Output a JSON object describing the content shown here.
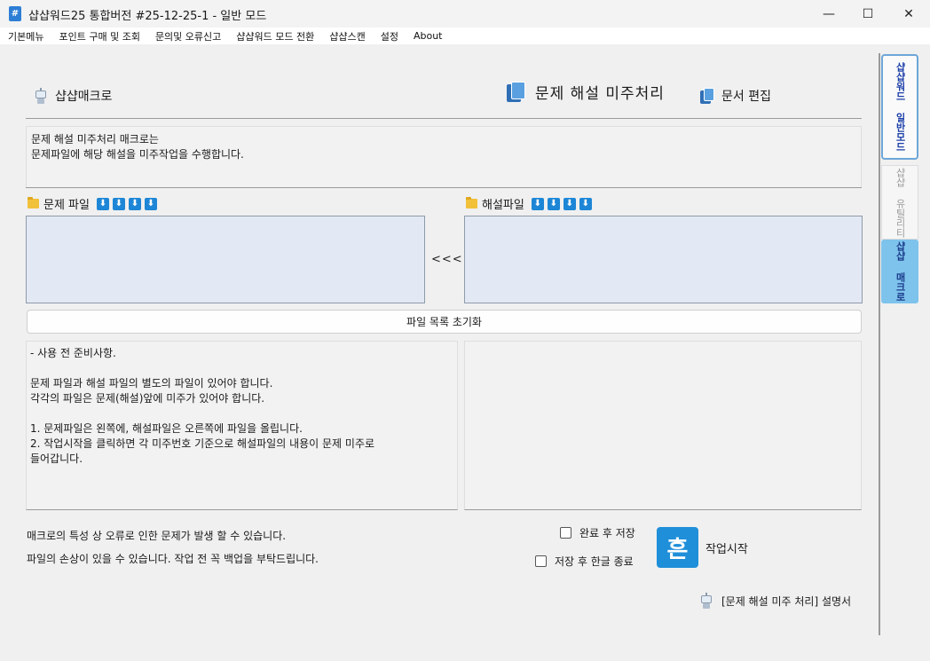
{
  "window": {
    "title": "샵샵워드25 통합버전 #25-12-25-1 - 일반 모드",
    "minimize": "—",
    "maximize": "☐",
    "close": "✕"
  },
  "menu": {
    "items": [
      "기본메뉴",
      "포인트 구매 및 조회",
      "문의및 오류신고",
      "샵샵워드 모드 전환",
      "샵샵스캔",
      "설정",
      "About"
    ]
  },
  "sidebar_tabs": {
    "mode": "샵샵워드 일반모드",
    "utility": "샵샵 유틸리티",
    "macro": "샵샵 매크로"
  },
  "header": {
    "macro_label": "샵샵매크로",
    "page_title": "문제 해설 미주처리",
    "doc_edit": "문서 편집"
  },
  "description": {
    "line1": "문제 해설 미주처리 매크로는",
    "line2": "문제파일에 해당 해설을 미주작업을 수행합니다."
  },
  "problem_file": {
    "label": "문제 파일",
    "icons": [
      "download-icon",
      "download-icon",
      "download-icon",
      "download-icon"
    ]
  },
  "answer_file": {
    "label": "해설파일",
    "icons": [
      "download-icon",
      "download-icon",
      "download-icon",
      "download-icon"
    ]
  },
  "arrow": "<<<<",
  "reset_button": "파일 목록 초기화",
  "notes": {
    "text": "- 사용 전 준비사항.\n\n문제 파일과 해설 파일의 별도의 파일이 있어야 합니다.\n각각의 파일은 문제(해설)앞에 미주가 있어야 합니다.\n\n1. 문제파일은 왼쪽에, 해설파일은 오른쪽에 파일을 올립니다.\n2. 작업시작을 클릭하면 각 미주번호 기준으로 해설파일의 내용이 문제 미주로\n들어갑니다."
  },
  "warnings": {
    "line1": "매크로의 특성 상 오류로 인한 문제가 발생 할 수 있습니다.",
    "line2": "파일의 손상이 있을 수 있습니다. 작업 전 꼭 백업을 부탁드립니다."
  },
  "options": {
    "save_after": "완료 후 저장",
    "close_after": "저장 후 한글 종료"
  },
  "start": {
    "icon_glyph": "흔",
    "label": "작업시작"
  },
  "manual_link": "[문제 해설 미주 처리] 설명서"
}
